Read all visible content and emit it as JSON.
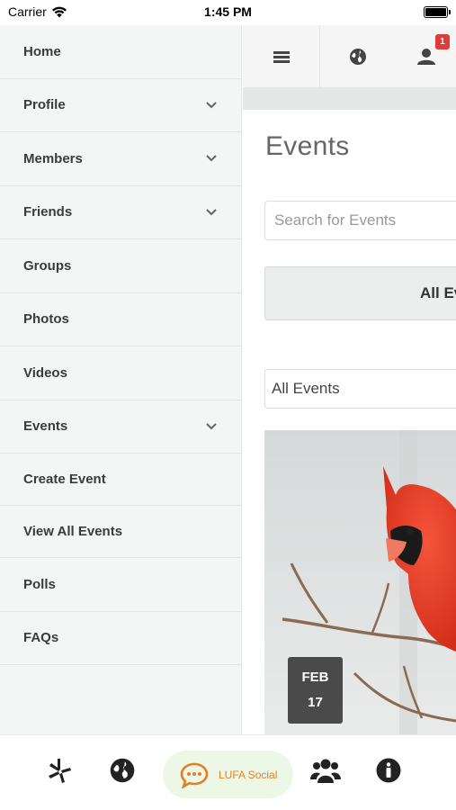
{
  "status_bar": {
    "carrier": "Carrier",
    "time": "1:45 PM"
  },
  "sidebar": {
    "items": [
      {
        "label": "Home",
        "expandable": false
      },
      {
        "label": "Profile",
        "expandable": true
      },
      {
        "label": "Members",
        "expandable": true
      },
      {
        "label": "Friends",
        "expandable": true
      },
      {
        "label": "Groups",
        "expandable": false
      },
      {
        "label": "Photos",
        "expandable": false
      },
      {
        "label": "Videos",
        "expandable": false
      },
      {
        "label": "Events",
        "expandable": true
      },
      {
        "label": "Create Event",
        "expandable": false
      },
      {
        "label": "View All Events",
        "expandable": false
      },
      {
        "label": "Polls",
        "expandable": false
      },
      {
        "label": "FAQs",
        "expandable": false
      }
    ]
  },
  "toolbar": {
    "icons": [
      "menu-icon",
      "globe-icon",
      "friend-requests-icon"
    ],
    "notification_count": "1"
  },
  "main": {
    "title": "Events",
    "search_placeholder": "Search for Events",
    "segment_label": "All Events",
    "filter_selected": "All Events",
    "event_card": {
      "month": "FEB",
      "day": "17"
    }
  },
  "tabbar": {
    "items": [
      "yelp-icon",
      "globe-icon",
      "chat-icon",
      "groups-icon",
      "info-icon"
    ],
    "center_label": "LUFA Social"
  },
  "colors": {
    "accent": "#e67e22",
    "badge": "#e03a3a",
    "center_tab_bg": "#ecf7e6",
    "sidebar_bg": "#f4f5f5"
  }
}
